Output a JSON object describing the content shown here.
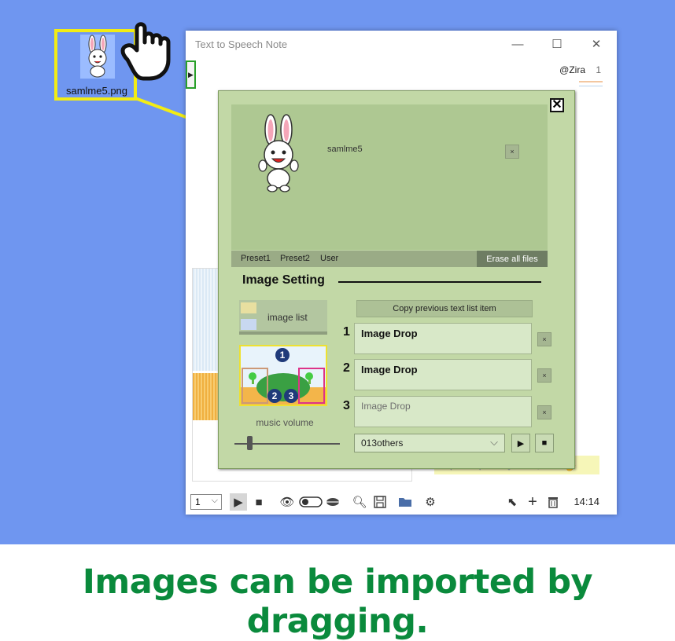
{
  "desktop": {
    "file_label": "samlme5.png",
    "file_icon": "rabbit-image-icon",
    "pointer_icon": "hand-pointer-icon"
  },
  "window": {
    "title": "Text to Speech Note",
    "controls": {
      "minimize": "—",
      "maximize": "☐",
      "close": "✕"
    },
    "side_toggle": "▶",
    "voice_tag": "@Zira",
    "voice_number": "1"
  },
  "dialog": {
    "close": "✕",
    "image_name": "samlme5",
    "image_remove": "×",
    "tabs": [
      "Preset1",
      "Preset2",
      "User"
    ],
    "erase_all": "Erase all files",
    "section_title": "Image Setting",
    "image_list_label": "image list",
    "scene_badges": [
      "1",
      "2",
      "3"
    ],
    "music_volume_label": "music volume",
    "music_volume": 0.12,
    "copy_button": "Copy previous text list item",
    "slots": [
      {
        "number": "1",
        "text": "Image Drop",
        "remove": "×"
      },
      {
        "number": "2",
        "text": "Image Drop",
        "remove": "×"
      },
      {
        "number": "3",
        "text": "Image Drop",
        "remove": "×"
      }
    ],
    "music_select": "013others",
    "play": "▶",
    "stop": "■"
  },
  "toolbar": {
    "page_select": "1",
    "time": "14:14",
    "icons": [
      "play-icon",
      "stop-icon",
      "eye-icon",
      "toggle-icon",
      "lips-icon",
      "search-icon",
      "save-icon",
      "folder-icon",
      "gear-icon",
      "undo-icon",
      "add-icon",
      "trash-icon"
    ]
  },
  "caption": "Images can be imported by dragging."
}
